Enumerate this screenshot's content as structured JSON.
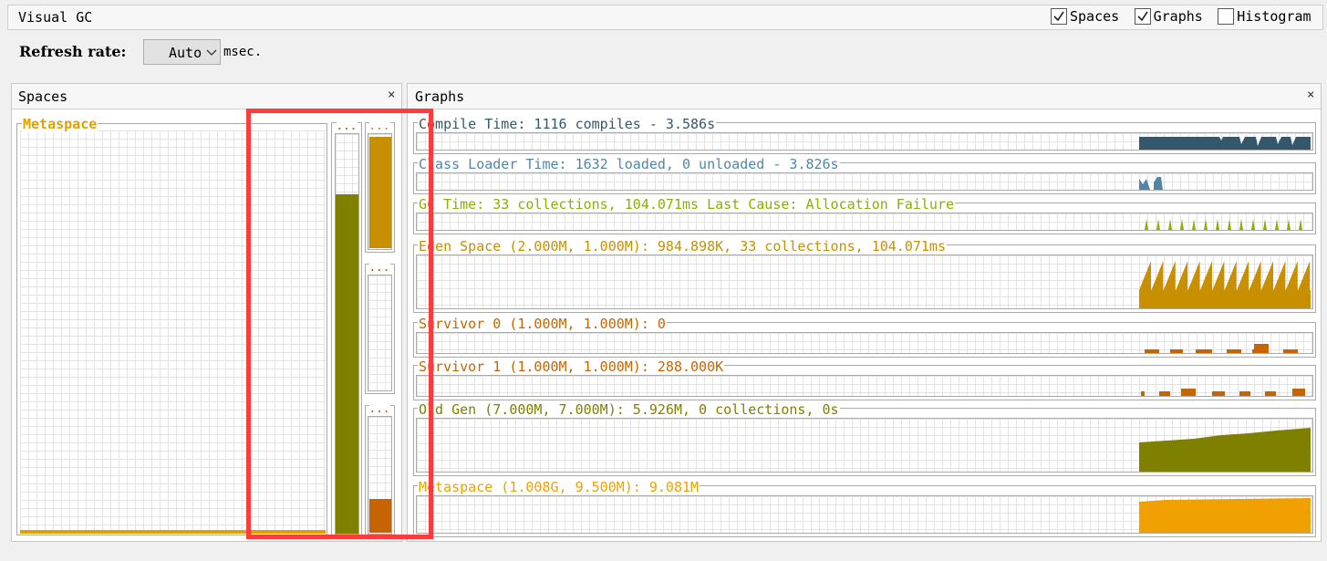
{
  "window": {
    "title": "Visual GC"
  },
  "toolbar": {
    "checkboxes": [
      {
        "label": "Spaces",
        "checked": true
      },
      {
        "label": "Graphs",
        "checked": true
      },
      {
        "label": "Histogram",
        "checked": false
      }
    ],
    "refresh_label": "Refresh rate:",
    "refresh_value": "Auto",
    "refresh_unit": "msec."
  },
  "spaces_panel": {
    "title": "Spaces",
    "close": "×",
    "metaspace_label": "Metaspace",
    "column_dots": "...",
    "metaspace_fill": 0.01,
    "old_gen_fill": 0.85,
    "eden_fill": 0.98,
    "survivor0_fill": 0.0,
    "survivor1_fill": 0.29,
    "colors": {
      "metaspace": "#e0a000",
      "old_gen": "#808000",
      "eden": "#c89000",
      "survivor": "#c86400"
    }
  },
  "graphs_panel": {
    "title": "Graphs",
    "close": "×",
    "rows": [
      {
        "label": "Compile Time: 1116 compiles - 3.586s",
        "color": "#35576b"
      },
      {
        "label": "Class Loader Time: 1632 loaded, 0 unloaded - 3.826s",
        "color": "#4f86a8"
      },
      {
        "label": "GC Time: 33 collections, 104.071ms Last Cause: Allocation Failure",
        "color": "#8ab000"
      },
      {
        "label": "Eden Space (2.000M, 1.000M): 984.898K, 33 collections, 104.071ms",
        "color": "#c89000"
      },
      {
        "label": "Survivor 0 (1.000M, 1.000M): 0",
        "color": "#c86400"
      },
      {
        "label": "Survivor 1 (1.000M, 1.000M): 288.000K",
        "color": "#c86400"
      },
      {
        "label": "Old Gen (7.000M, 7.000M): 5.926M, 0 collections, 0s",
        "color": "#808000"
      },
      {
        "label": "Metaspace (1.008G, 9.500M): 9.081M",
        "color": "#f0a000"
      }
    ]
  },
  "highlight": {
    "color": "#ff3b3b"
  }
}
